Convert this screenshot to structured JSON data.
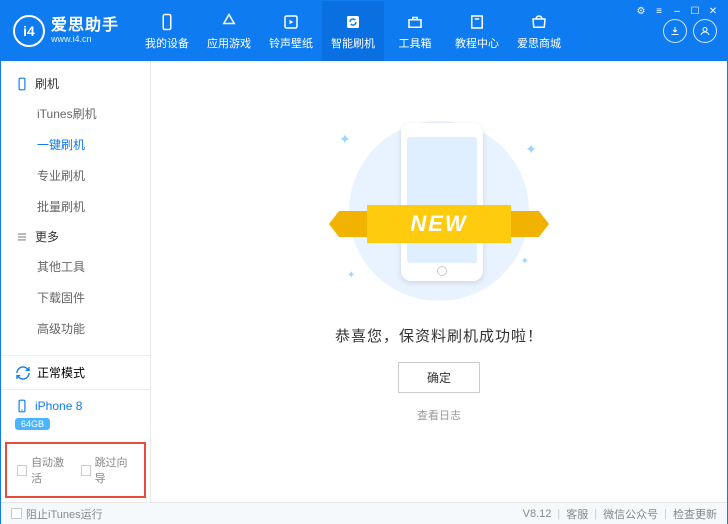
{
  "logo": {
    "badge": "i4",
    "title": "爱思助手",
    "url": "www.i4.cn"
  },
  "nav": [
    {
      "label": "我的设备",
      "icon": "phone"
    },
    {
      "label": "应用游戏",
      "icon": "app"
    },
    {
      "label": "铃声壁纸",
      "icon": "music"
    },
    {
      "label": "智能刷机",
      "icon": "refresh",
      "active": true
    },
    {
      "label": "工具箱",
      "icon": "toolbox"
    },
    {
      "label": "教程中心",
      "icon": "book"
    },
    {
      "label": "爱思商城",
      "icon": "shop"
    }
  ],
  "sidebar": {
    "group1": "刷机",
    "group1_items": [
      "iTunes刷机",
      "一键刷机",
      "专业刷机",
      "批量刷机"
    ],
    "group1_active_index": 1,
    "group2": "更多",
    "group2_items": [
      "其他工具",
      "下载固件",
      "高级功能"
    ],
    "mode": "正常模式",
    "device": "iPhone 8",
    "storage": "64GB",
    "check_auto": "自动激活",
    "check_skip": "跳过向导"
  },
  "main": {
    "ribbon": "NEW",
    "success": "恭喜您，保资料刷机成功啦！",
    "confirm": "确定",
    "log": "查看日志"
  },
  "status": {
    "block_itunes": "阻止iTunes运行",
    "version": "V8.12",
    "support": "客服",
    "wechat": "微信公众号",
    "update": "检查更新"
  }
}
